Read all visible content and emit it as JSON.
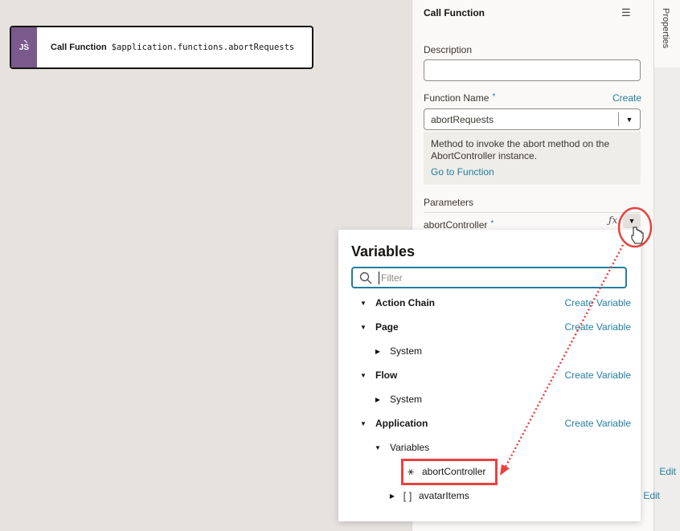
{
  "canvas": {
    "node": {
      "icon": "javascript-icon",
      "icon_text": "JS",
      "title": "Call Function",
      "expression": "$application.functions.abortRequests",
      "accent_color": "#7a5a8c"
    }
  },
  "properties": {
    "title": "Call Function",
    "menu_icon": "hamburger-icon",
    "description_label": "Description",
    "description_value": "",
    "function_name_label": "Function Name",
    "required_marker": "*",
    "create_link": "Create",
    "function_name_value": "abortRequests",
    "function_help": "Method to invoke the abort method on the AbortController instance.",
    "go_to_function_link": "Go to Function",
    "parameters_label": "Parameters",
    "parameter_name": "abortController",
    "fx_label": "ƒx"
  },
  "side_tab": {
    "label": "Properties"
  },
  "variables_popup": {
    "title": "Variables",
    "filter_placeholder": "Filter",
    "filter_value": "",
    "create_variable_label": "Create Variable",
    "edit_label": "Edit",
    "sections": [
      {
        "label": "Action Chain",
        "expanded": true
      },
      {
        "label": "Page",
        "expanded": true,
        "children": [
          {
            "label": "System",
            "expanded": false
          }
        ]
      },
      {
        "label": "Flow",
        "expanded": true,
        "children": [
          {
            "label": "System",
            "expanded": false
          }
        ]
      },
      {
        "label": "Application",
        "expanded": true,
        "children": [
          {
            "label": "Variables",
            "expanded": true,
            "items": [
              {
                "name": "abortController",
                "type_icon": "any-type-icon",
                "type_glyph": "⚹",
                "highlighted": true
              },
              {
                "name": "avatarItems",
                "type_icon": "array-type-icon",
                "type_glyph": "[ ]",
                "expanded": false
              }
            ]
          }
        ]
      }
    ]
  },
  "annotation": {
    "color": "#e8423f"
  },
  "colors": {
    "link": "#227e9e",
    "canvas_bg": "#e6e3df",
    "panel_bg": "#fbf9f8"
  }
}
